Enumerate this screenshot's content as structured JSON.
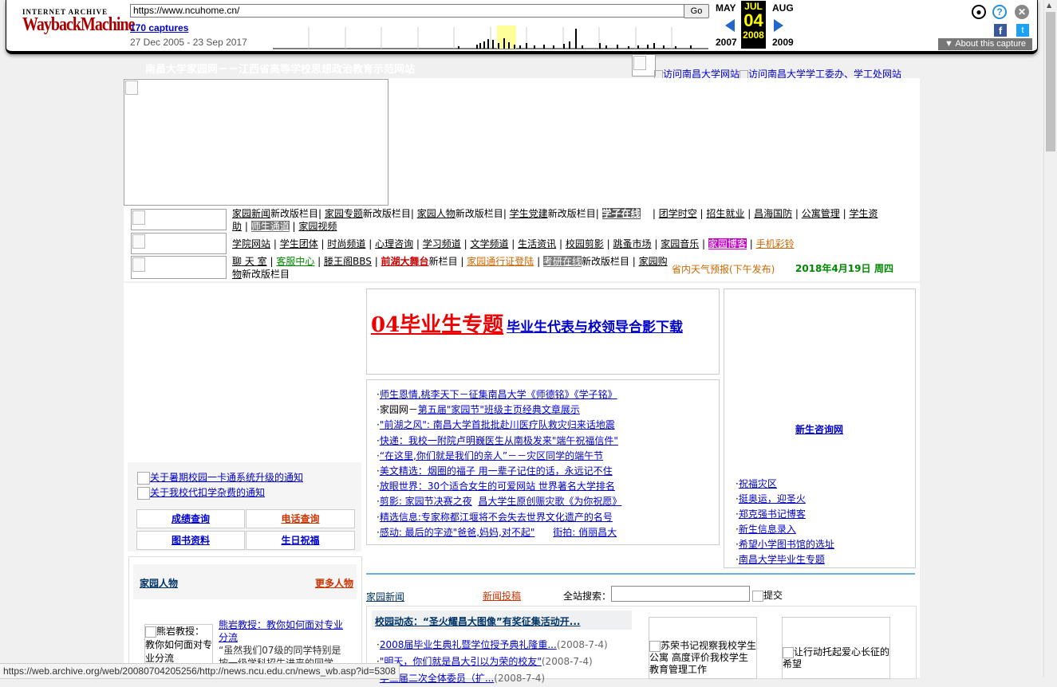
{
  "wayback": {
    "logo_top": "INTERNET ARCHIVE",
    "logo_main": "WaybackMachine",
    "url": "https://www.ncuhome.cn/",
    "go": "Go",
    "captures": "170 captures",
    "range": "27 Dec 2005 - 23 Sep 2017",
    "prev_month": "MAY",
    "cur_month": "JUL",
    "next_month": "AUG",
    "day": "04",
    "prev_year": "2007",
    "cur_year": "2008",
    "next_year": "2009",
    "about": "▼ About this capture"
  },
  "header": {
    "site_title": "南昌大学家园网－－江西省高等学校思想政治教育示范网站",
    "link_ncu": "访问南昌大学网站",
    "link_xgc": "访问南昌大学学工委办、学工处网站"
  },
  "nav": {
    "row1": [
      "家园新闻",
      "新改版栏目",
      "家园专题",
      "新改版栏目",
      "家园人物",
      "新改版栏目",
      "学生党建",
      "新改版栏目",
      "学子在线",
      "团学时空",
      "招生就业",
      "昌海国防",
      "公寓管理",
      "学生资助",
      "师生通道",
      "家园视频"
    ],
    "row2": [
      "学院网站",
      "学生团体",
      "时尚频道",
      "心理咨询",
      "学习频道",
      "文学频道",
      "生活资讯",
      "校园剪影",
      "跳蚤市场",
      "家园音乐",
      "家园博客",
      "手机彩铃"
    ],
    "row3": [
      "聊 天 室",
      "客服中心",
      "滕王阁BBS",
      "前湖大舞台",
      "新栏目",
      "家园通行证登陆",
      "考研在线",
      "新改版栏目",
      "家园购物",
      "新改版栏目"
    ],
    "weather": "省内天气预报(下午发布)",
    "date": "2018年4月19日",
    "weekday": "周四"
  },
  "left": {
    "notices": [
      "关于暑期校园一卡通系统升级的通知",
      "关于我校代扣学杂费的通知"
    ],
    "quick": [
      "成绩查询",
      "电话查询",
      "图书资料",
      "生日祝福"
    ],
    "people_title": "家园人物",
    "people_more": "更多人物",
    "people_img_alt": "熊岩教授：教你如何面对专业分流",
    "people_link": "熊岩教授：教你如何面对专业分流",
    "people_desc": "“虽然我们07级的同学特别是按一级学科招生进来的同学"
  },
  "center": {
    "feature_title": "04毕业生专题",
    "feature_sub": "毕业生代表与校领导合影下载",
    "news": [
      {
        "a": "师生恩情,桃李天下－征集南昌大学《师德铭》《学子铭》",
        "b": ""
      },
      {
        "a": "家园网－",
        "b": "第五届\"家园节\"班级主页经典文章展示"
      },
      {
        "a": "\"前湖之风\": 南昌大学首批批赴川医疗队救灾归来话地震",
        "b": ""
      },
      {
        "a": "快递：我校一附院卢明巍医生从南极发来\"端午祝福信件\"",
        "b": ""
      },
      {
        "a": "“在这里,你们就是我们的亲人”－－灾区同学的端午节",
        "b": ""
      },
      {
        "a": "美文精选：",
        "b": "烟圈的福子  用一辈子记住的话，永远记不住"
      },
      {
        "a": "放眼世界：",
        "b": "30个适合女生的可爱网站    世界著名大学排名"
      },
      {
        "a": "剪影: 家园节决赛之夜",
        "b": "昌大学生原创赈灾歌《为你祝愿》"
      },
      {
        "a": "精选信息:专家称都江堰将不会失去世界文化遗产的名号",
        "b": ""
      },
      {
        "a": "感动: 最后的字迹\"爸爸,妈妈,对不起\"",
        "b": "街拍: 俏丽昌大"
      }
    ],
    "news_tab": "家园新闻",
    "news_submit": "新闻投稿",
    "search_label": "全站搜索：",
    "search_btn": "提交",
    "campus_head": "校园动态：“圣火耀昌大图像”有奖征集活动开...",
    "campus_items": [
      {
        "t": "2008届毕业生典礼暨学位授予典礼隆重...",
        "d": "(2008-7-4)"
      },
      {
        "t": "\"明天，你们就是昌大引以为荣的校友\"",
        "d": "(2008-7-4)"
      },
      {
        "t": "学三届二次全体委员（扩...",
        "d": "(2008-7-4)"
      }
    ],
    "photo1": "苏荣书记视察我校学生公寓 高度评价我校学生教育管理工作",
    "photo2": "让行动托起爱心长征的希望"
  },
  "right": {
    "title": "新生咨询网",
    "items": [
      "祝福灾区",
      "挺奥运，迎圣火",
      "郑克强书记博客",
      "新生信息录入",
      "希望小学图书馆的选址",
      "南昌大学毕业生专题"
    ]
  },
  "status_bar": "https://web.archive.org/web/20080704205256/http://news.ncu.edu.cn/news_wb.asp?id=5308"
}
